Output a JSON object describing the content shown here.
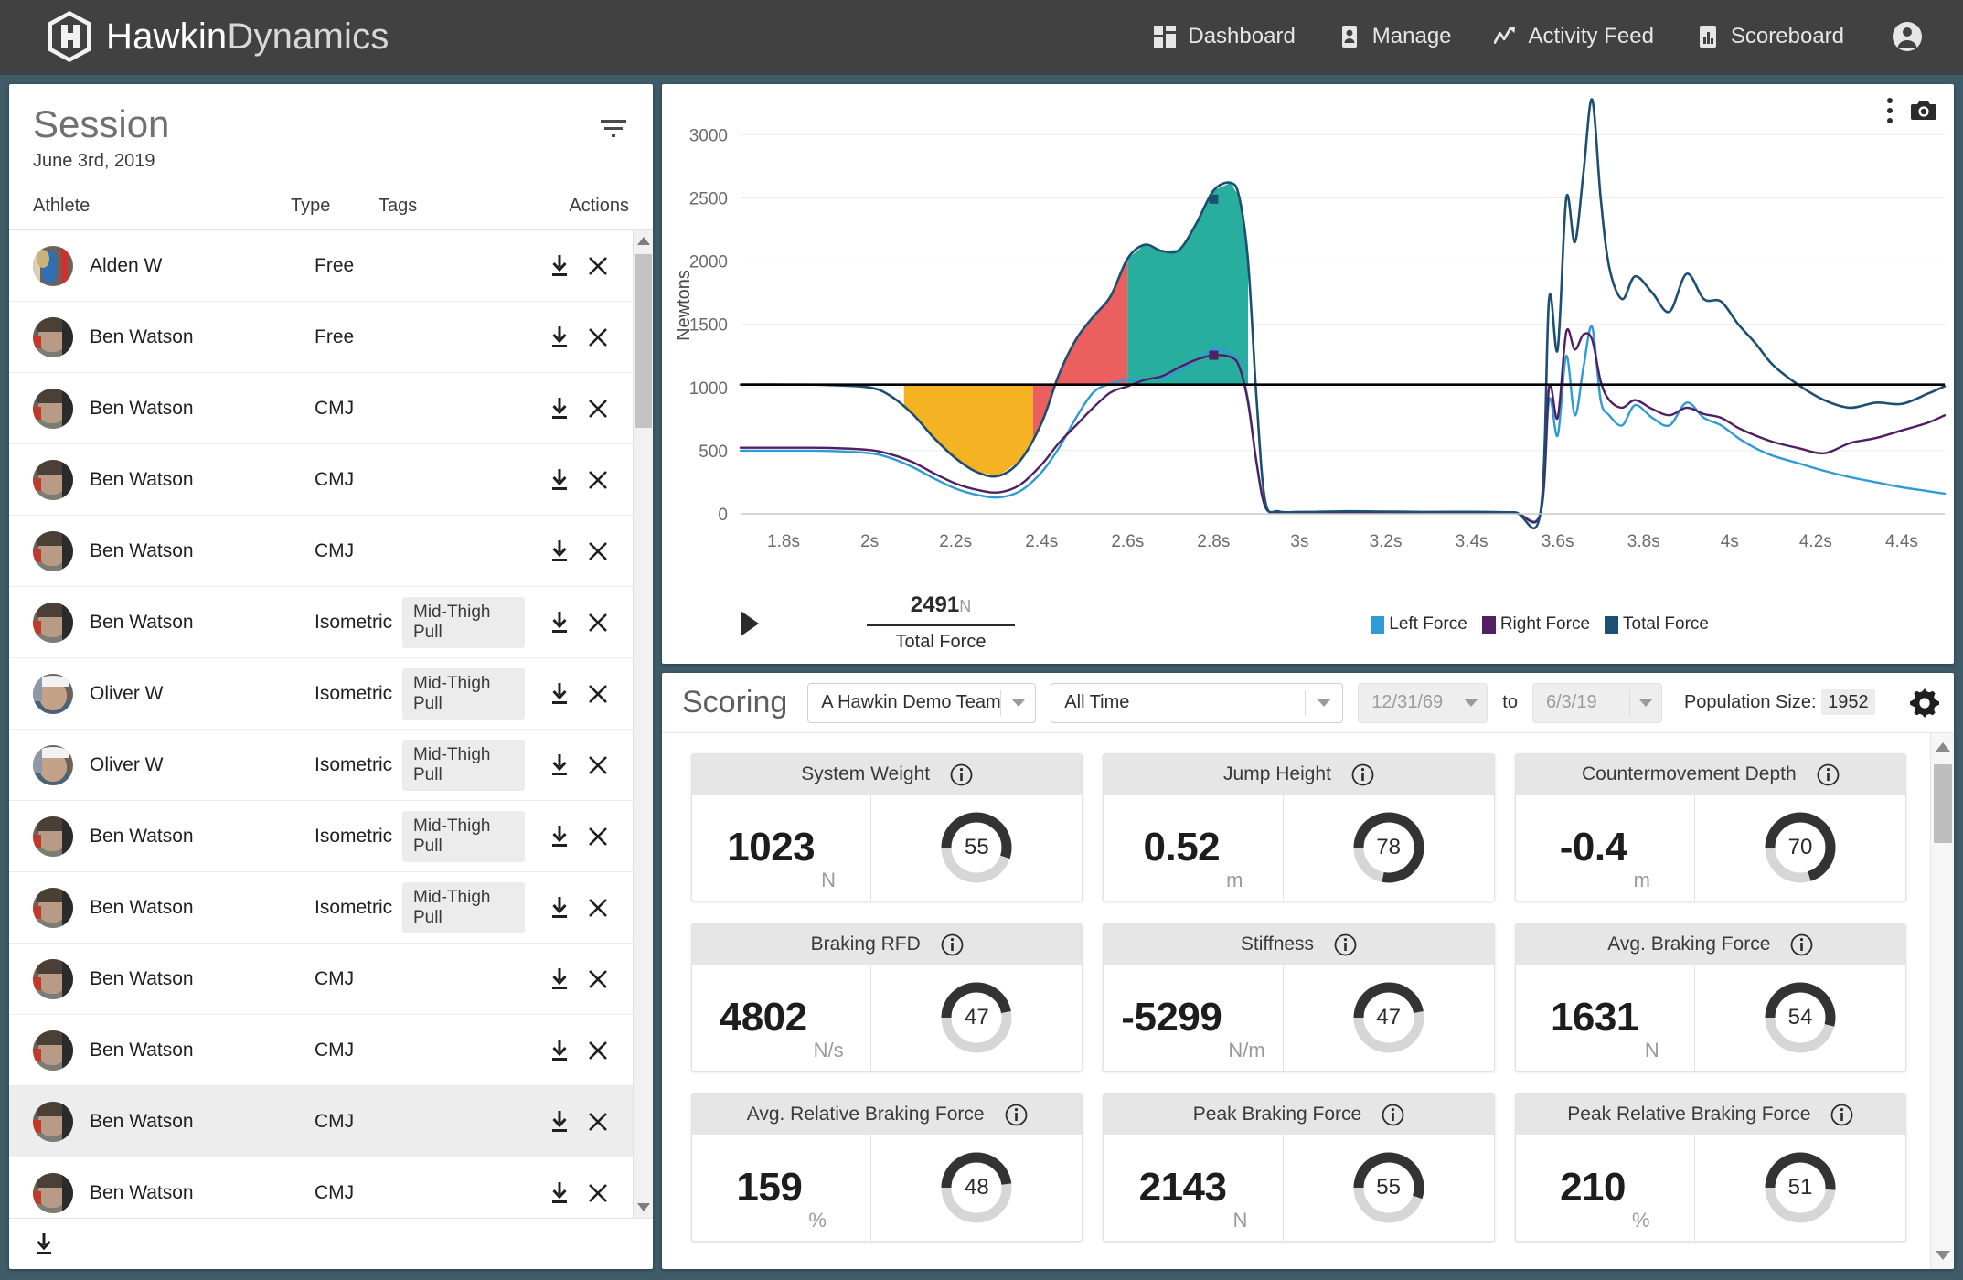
{
  "brand": {
    "name_bold": "Hawkin",
    "name_light": "Dynamics",
    "logo_icon": "hexagon-h-logo-icon"
  },
  "nav": {
    "items": [
      {
        "label": "Dashboard",
        "icon": "grid-dashboard-icon"
      },
      {
        "label": "Manage",
        "icon": "person-card-icon"
      },
      {
        "label": "Activity Feed",
        "icon": "trend-line-icon"
      },
      {
        "label": "Scoreboard",
        "icon": "bar-chart-icon"
      }
    ],
    "account_icon": "account-circle-icon"
  },
  "session": {
    "title": "Session",
    "date": "June 3rd, 2019",
    "filter_icon": "filter-icon",
    "columns": {
      "athlete": "Athlete",
      "type": "Type",
      "tags": "Tags",
      "actions": "Actions"
    },
    "rows": [
      {
        "name": "Alden W",
        "type": "Free",
        "tag": "",
        "avatar": "av-alden",
        "selected": false
      },
      {
        "name": "Ben Watson",
        "type": "Free",
        "tag": "",
        "avatar": "av-ben",
        "selected": false
      },
      {
        "name": "Ben Watson",
        "type": "CMJ",
        "tag": "",
        "avatar": "av-ben",
        "selected": false
      },
      {
        "name": "Ben Watson",
        "type": "CMJ",
        "tag": "",
        "avatar": "av-ben",
        "selected": false
      },
      {
        "name": "Ben Watson",
        "type": "CMJ",
        "tag": "",
        "avatar": "av-ben",
        "selected": false
      },
      {
        "name": "Ben Watson",
        "type": "Isometric",
        "tag": "Mid-Thigh Pull",
        "avatar": "av-ben",
        "selected": false
      },
      {
        "name": "Oliver W",
        "type": "Isometric",
        "tag": "Mid-Thigh Pull",
        "avatar": "av-oli",
        "selected": false
      },
      {
        "name": "Oliver W",
        "type": "Isometric",
        "tag": "Mid-Thigh Pull",
        "avatar": "av-oli",
        "selected": false
      },
      {
        "name": "Ben Watson",
        "type": "Isometric",
        "tag": "Mid-Thigh Pull",
        "avatar": "av-ben",
        "selected": false
      },
      {
        "name": "Ben Watson",
        "type": "Isometric",
        "tag": "Mid-Thigh Pull",
        "avatar": "av-ben",
        "selected": false
      },
      {
        "name": "Ben Watson",
        "type": "CMJ",
        "tag": "",
        "avatar": "av-ben",
        "selected": false
      },
      {
        "name": "Ben Watson",
        "type": "CMJ",
        "tag": "",
        "avatar": "av-ben",
        "selected": false
      },
      {
        "name": "Ben Watson",
        "type": "CMJ",
        "tag": "",
        "avatar": "av-ben",
        "selected": true
      },
      {
        "name": "Ben Watson",
        "type": "CMJ",
        "tag": "",
        "avatar": "av-ben",
        "selected": false
      }
    ],
    "row_download_icon": "download-icon",
    "row_delete_icon": "close-x-icon",
    "footer_download_icon": "download-all-icon"
  },
  "chart_panel": {
    "menu_icon": "kebab-menu-icon",
    "camera_icon": "camera-screenshot-icon",
    "play_icon": "play-icon",
    "tooltip": {
      "value": "2491",
      "unit": "N",
      "label": "Total Force"
    }
  },
  "chart_data": {
    "type": "line",
    "title": "",
    "xlabel": "",
    "ylabel": "Newtons",
    "xlim": [
      1.7,
      4.5
    ],
    "ylim": [
      0,
      3300
    ],
    "xticks": [
      "1.8s",
      "2s",
      "2.2s",
      "2.4s",
      "2.6s",
      "2.8s",
      "3s",
      "3.2s",
      "3.4s",
      "3.6s",
      "3.8s",
      "4s",
      "4.2s",
      "4.4s"
    ],
    "xtick_values": [
      1.8,
      2.0,
      2.2,
      2.4,
      2.6,
      2.8,
      3.0,
      3.2,
      3.4,
      3.6,
      3.8,
      4.0,
      4.2,
      4.4
    ],
    "yticks": [
      0,
      500,
      1000,
      1500,
      2000,
      2500,
      3000
    ],
    "grid": true,
    "legend_position": "bottom-right",
    "system_weight_line": 1023,
    "legend": [
      {
        "name": "Left Force",
        "color": "#2e9ad6"
      },
      {
        "name": "Right Force",
        "color": "#512063"
      },
      {
        "name": "Total Force",
        "color": "#1c4f72"
      }
    ],
    "phase_fills": [
      {
        "name": "unweighting",
        "color": "#f5b324",
        "x_start": 2.08,
        "x_end": 2.38
      },
      {
        "name": "braking",
        "color": "#ec5f5f",
        "x_start": 2.38,
        "x_end": 2.6
      },
      {
        "name": "propulsive",
        "color": "#27ae9e",
        "x_start": 2.6,
        "x_end": 2.88
      }
    ],
    "markers": [
      {
        "series": "Total Force",
        "x": 2.8,
        "y": 2491
      },
      {
        "series": "Left Force",
        "x": 2.8,
        "y": 1290
      },
      {
        "series": "Right Force",
        "x": 2.8,
        "y": 1255
      }
    ],
    "series": [
      {
        "name": "Total Force",
        "color": "#1c4f72",
        "x": [
          1.7,
          1.8,
          1.9,
          2.0,
          2.05,
          2.1,
          2.15,
          2.2,
          2.25,
          2.3,
          2.35,
          2.4,
          2.44,
          2.48,
          2.52,
          2.56,
          2.6,
          2.64,
          2.68,
          2.72,
          2.76,
          2.8,
          2.84,
          2.86,
          2.88,
          2.9,
          2.92,
          2.95,
          3.0,
          3.1,
          3.2,
          3.3,
          3.4,
          3.5,
          3.56,
          3.58,
          3.6,
          3.62,
          3.64,
          3.66,
          3.68,
          3.7,
          3.72,
          3.75,
          3.78,
          3.82,
          3.86,
          3.9,
          3.94,
          3.98,
          4.02,
          4.06,
          4.1,
          4.16,
          4.22,
          4.28,
          4.34,
          4.4,
          4.46,
          4.5
        ],
        "y": [
          1023,
          1023,
          1020,
          1000,
          930,
          790,
          600,
          440,
          330,
          300,
          420,
          720,
          1100,
          1380,
          1560,
          1720,
          2020,
          2130,
          2080,
          2090,
          2300,
          2560,
          2620,
          2500,
          2000,
          900,
          100,
          20,
          15,
          20,
          18,
          15,
          16,
          12,
          10,
          1700,
          1300,
          2500,
          2150,
          2700,
          3280,
          2500,
          1950,
          1700,
          1880,
          1750,
          1600,
          1900,
          1700,
          1680,
          1500,
          1350,
          1180,
          1020,
          900,
          840,
          880,
          870,
          950,
          1010
        ]
      },
      {
        "name": "Left Force",
        "color": "#2e9ad6",
        "x": [
          1.7,
          1.8,
          1.9,
          2.0,
          2.05,
          2.1,
          2.15,
          2.2,
          2.25,
          2.3,
          2.35,
          2.4,
          2.44,
          2.48,
          2.52,
          2.56,
          2.6,
          2.64,
          2.68,
          2.72,
          2.76,
          2.8,
          2.84,
          2.86,
          2.88,
          2.9,
          2.92,
          2.95,
          3.0,
          3.1,
          3.2,
          3.3,
          3.4,
          3.5,
          3.56,
          3.58,
          3.6,
          3.62,
          3.64,
          3.66,
          3.68,
          3.7,
          3.72,
          3.75,
          3.78,
          3.82,
          3.86,
          3.9,
          3.94,
          3.98,
          4.02,
          4.06,
          4.1,
          4.16,
          4.22,
          4.28,
          4.34,
          4.4,
          4.46,
          4.5
        ],
        "y": [
          500,
          500,
          498,
          480,
          440,
          370,
          280,
          200,
          150,
          130,
          180,
          330,
          520,
          760,
          960,
          1030,
          1060,
          1060,
          1080,
          1130,
          1220,
          1290,
          1270,
          1180,
          900,
          400,
          60,
          10,
          8,
          10,
          9,
          8,
          8,
          6,
          5,
          900,
          620,
          1250,
          780,
          1160,
          1480,
          900,
          780,
          700,
          860,
          760,
          700,
          880,
          760,
          700,
          600,
          520,
          460,
          400,
          340,
          290,
          250,
          210,
          180,
          160
        ]
      },
      {
        "name": "Right Force",
        "color": "#512063",
        "x": [
          1.7,
          1.8,
          1.9,
          2.0,
          2.05,
          2.1,
          2.15,
          2.2,
          2.25,
          2.3,
          2.35,
          2.4,
          2.44,
          2.48,
          2.52,
          2.56,
          2.6,
          2.64,
          2.68,
          2.72,
          2.76,
          2.8,
          2.84,
          2.86,
          2.88,
          2.9,
          2.92,
          2.95,
          3.0,
          3.1,
          3.2,
          3.3,
          3.4,
          3.5,
          3.56,
          3.58,
          3.6,
          3.62,
          3.64,
          3.66,
          3.68,
          3.7,
          3.72,
          3.75,
          3.78,
          3.82,
          3.86,
          3.9,
          3.94,
          3.98,
          4.02,
          4.06,
          4.1,
          4.16,
          4.22,
          4.28,
          4.34,
          4.4,
          4.46,
          4.5
        ],
        "y": [
          523,
          523,
          522,
          505,
          470,
          410,
          320,
          240,
          190,
          170,
          230,
          390,
          560,
          700,
          840,
          960,
          1010,
          1060,
          1090,
          1160,
          1220,
          1255,
          1240,
          1160,
          880,
          400,
          55,
          10,
          8,
          10,
          9,
          8,
          8,
          6,
          5,
          1000,
          760,
          1440,
          1300,
          1420,
          1380,
          1050,
          900,
          840,
          900,
          830,
          780,
          840,
          790,
          760,
          680,
          620,
          570,
          520,
          480,
          560,
          600,
          660,
          720,
          780
        ]
      }
    ]
  },
  "scoring": {
    "title": "Scoring",
    "team": "A Hawkin Demo Team",
    "time_range": "All Time",
    "date_from": "12/31/69",
    "to_label": "to",
    "date_to": "6/3/19",
    "population_label": "Population Size:",
    "population_size": "1952",
    "settings_icon": "gear-icon",
    "info_icon": "info-icon",
    "cards": [
      {
        "title": "System Weight",
        "value": "1023",
        "unit": "N",
        "score": 55
      },
      {
        "title": "Jump Height",
        "value": "0.52",
        "unit": "m",
        "score": 78
      },
      {
        "title": "Countermovement Depth",
        "value": "-0.4",
        "unit": "m",
        "score": 70
      },
      {
        "title": "Braking RFD",
        "value": "4802",
        "unit": "N/s",
        "score": 47
      },
      {
        "title": "Stiffness",
        "value": "-5299",
        "unit": "N/m",
        "score": 47
      },
      {
        "title": "Avg. Braking Force",
        "value": "1631",
        "unit": "N",
        "score": 54
      },
      {
        "title": "Avg. Relative Braking Force",
        "value": "159",
        "unit": "%",
        "score": 48
      },
      {
        "title": "Peak Braking Force",
        "value": "2143",
        "unit": "N",
        "score": 55
      },
      {
        "title": "Peak Relative Braking Force",
        "value": "210",
        "unit": "%",
        "score": 51
      }
    ]
  },
  "colors": {
    "topbar": "#414141",
    "app_background": "#3f5c68",
    "gauge_track": "#d6d6d6",
    "gauge_fill": "#333333"
  }
}
